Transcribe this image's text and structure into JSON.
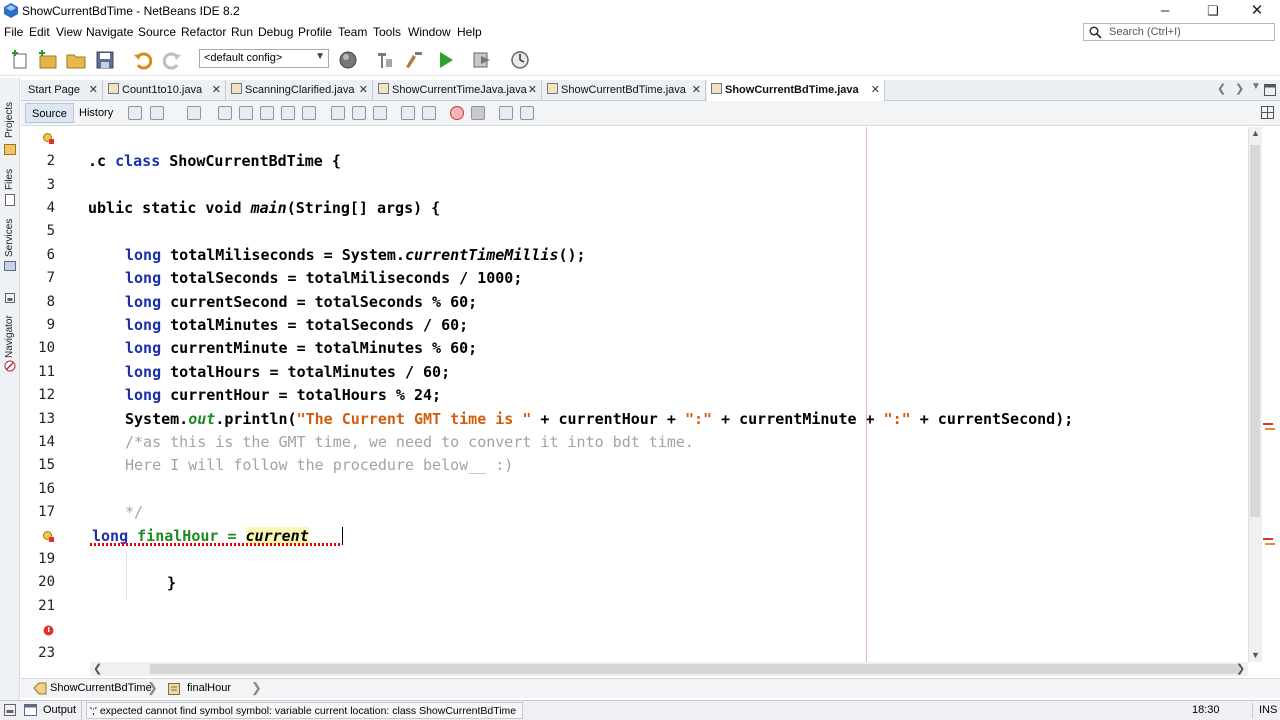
{
  "window": {
    "title": "ShowCurrentBdTime - NetBeans IDE 8.2",
    "minimize": "–",
    "maximize": "❏",
    "close": "✕"
  },
  "menu": [
    "File",
    "Edit",
    "View",
    "Navigate",
    "Source",
    "Refactor",
    "Run",
    "Debug",
    "Profile",
    "Team",
    "Tools",
    "Window",
    "Help"
  ],
  "search": {
    "placeholder": "Search (Ctrl+I)"
  },
  "toolbar": {
    "config": "<default config>"
  },
  "sidebar": [
    "Projects",
    "Files",
    "Services",
    "Navigator"
  ],
  "tabs": [
    {
      "label": "Start Page",
      "active": false
    },
    {
      "label": "Count1to10.java",
      "active": false
    },
    {
      "label": "ScanningClarified.java",
      "active": false
    },
    {
      "label": "ShowCurrentTimeJava.java",
      "active": false
    },
    {
      "label": "ShowCurrentBdTime.java",
      "active": false
    },
    {
      "label": "ShowCurrentBdTime.java",
      "active": true
    }
  ],
  "editor_tabs": {
    "source": "Source",
    "history": "History"
  },
  "line_numbers": [
    "2",
    "3",
    "4",
    "5",
    "6",
    "7",
    "8",
    "9",
    "10",
    "11",
    "12",
    "13",
    "14",
    "15",
    "16",
    "17",
    "19",
    "20",
    "21",
    "23"
  ],
  "code": {
    "l2": {
      "a": ".c ",
      "b": "class ",
      "c": "ShowCurrentBdTime {"
    },
    "l4": {
      "a": "ublic static void ",
      "b": "main",
      "c": "(String[] args) {"
    },
    "l6": {
      "a": "long ",
      "b": "totalMiliseconds = System.",
      "c": "currentTimeMillis",
      "d": "();"
    },
    "l7": {
      "a": "long ",
      "b": "totalSeconds = totalMiliseconds / 1000;"
    },
    "l8": {
      "a": "long ",
      "b": "currentSecond = totalSeconds % 60;"
    },
    "l9": {
      "a": "long ",
      "b": "totalMinutes = totalSeconds / 60;"
    },
    "l10": {
      "a": "long ",
      "b": "currentMinute = totalMinutes % 60;"
    },
    "l11": {
      "a": "long ",
      "b": "totalHours = totalMinutes / 60;"
    },
    "l12": {
      "a": "long ",
      "b": "currentHour = totalHours % 24;"
    },
    "l13": {
      "a": "System.",
      "b": "out",
      "c": ".println(",
      "d": "\"The Current GMT time is \"",
      "e": " + currentHour + ",
      "f": "\":\"",
      "g": " + currentMinute + ",
      "h": "\":\"",
      "i": " + currentSecond);"
    },
    "l14": "/*as this is the GMT time, we need to convert it into bdt time.",
    "l15": "Here I will follow the procedure below__ :)",
    "l17": "*/",
    "l18": {
      "a": "long ",
      "b": "finalHour = ",
      "c": "current"
    },
    "l20": "}"
  },
  "breadcrumb": {
    "class": "ShowCurrentBdTime",
    "field": "finalHour"
  },
  "status": {
    "output": "Output",
    "message": "';' expected  cannot find symbol   symbol:   variable current   location: class ShowCurrentBdTime",
    "position": "18:30",
    "mode": "INS"
  }
}
